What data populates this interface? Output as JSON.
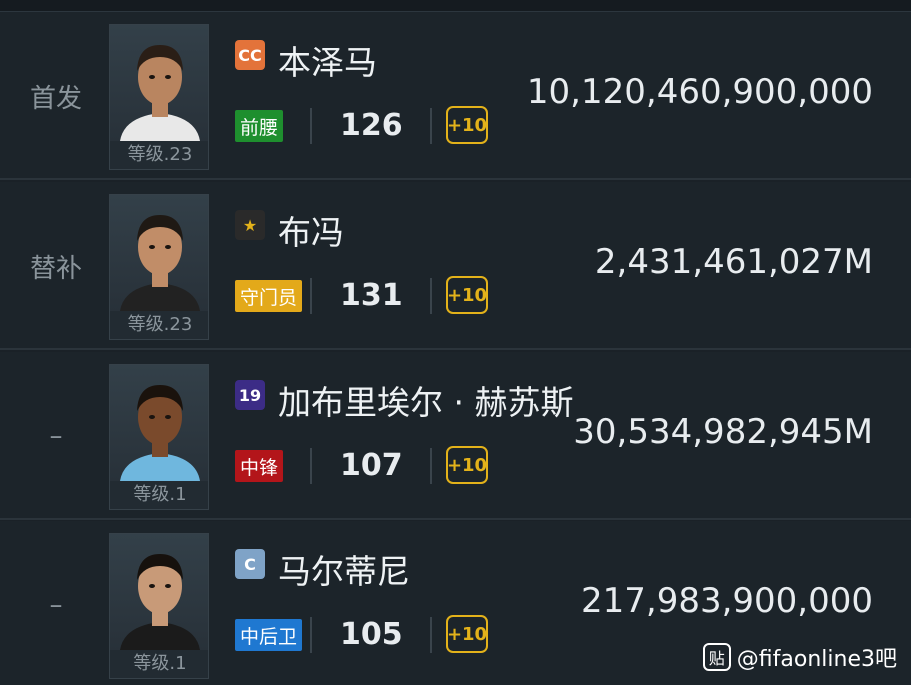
{
  "players": [
    {
      "status": "首发",
      "level": "等级.23",
      "season_badge": "CC",
      "name": "本泽马",
      "position": "前腰",
      "ovr": "126",
      "upgrade": "+10",
      "value": "10,120,460,900,000",
      "colors": {
        "badge_bg": "#e3733a",
        "badge_fg": "#ffffff",
        "pos_bg": "#1e8f2e",
        "skin": "#b98560",
        "hair": "#2a1e16",
        "shirt": "#e8e8e8"
      }
    },
    {
      "status": "替补",
      "level": "等级.23",
      "season_badge": "★",
      "name": "布冯",
      "position": "守门员",
      "ovr": "131",
      "upgrade": "+10",
      "value": "2,431,461,027M",
      "colors": {
        "badge_bg": "#2a2a2a",
        "badge_fg": "#e3b21a",
        "pos_bg": "#e3a91a",
        "skin": "#c18d68",
        "hair": "#1f1914",
        "shirt": "#222222"
      }
    },
    {
      "status": "–",
      "level": "等级.1",
      "season_badge": "19",
      "name": "加布里埃尔 · 赫苏斯",
      "position": "中锋",
      "ovr": "107",
      "upgrade": "+10",
      "value": "30,534,982,945M",
      "colors": {
        "badge_bg": "#3c2c86",
        "badge_fg": "#ffffff",
        "pos_bg": "#b3151a",
        "skin": "#7a4a2c",
        "hair": "#1a120c",
        "shirt": "#6fb7de"
      }
    },
    {
      "status": "–",
      "level": "等级.1",
      "season_badge": "C",
      "name": "马尔蒂尼",
      "position": "中后卫",
      "ovr": "105",
      "upgrade": "+10",
      "value": "217,983,900,000",
      "colors": {
        "badge_bg": "#7fa3c7",
        "badge_fg": "#ffffff",
        "pos_bg": "#1f78d1",
        "skin": "#c89a78",
        "hair": "#16110d",
        "shirt": "#1b1b1b"
      }
    }
  ],
  "watermark": {
    "icon": "贴",
    "icon_name": "tieba-icon",
    "text": "@fifaonline3吧"
  }
}
